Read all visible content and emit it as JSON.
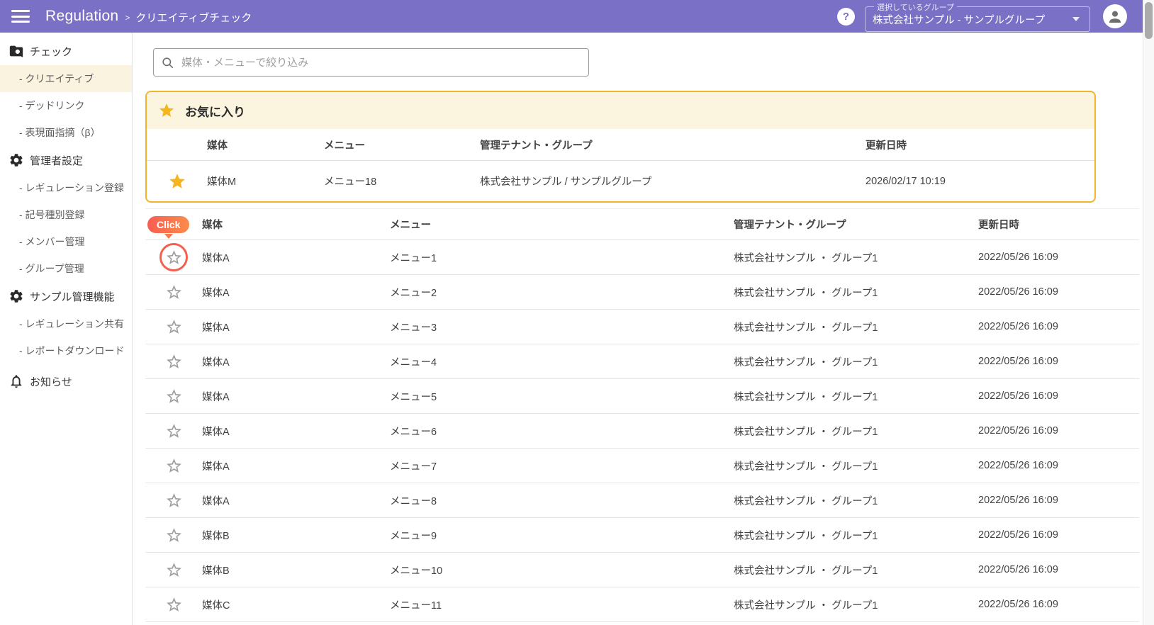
{
  "colors": {
    "header_purple": "#7A70C5",
    "accent_gold": "#F0B42A",
    "favorites_header_bg": "#FBF5DF",
    "active_item_bg": "#FAF3DF",
    "table_header_purple": "#6F66C3",
    "click_gradient_start": "#F85D52",
    "click_gradient_end": "#FB8C4A",
    "click_ring": "#F4604F",
    "star_gold": "#F5B51F",
    "star_gray": "#9E9E9E"
  },
  "header": {
    "app_title": "Regulation",
    "breadcrumb_separator": ">",
    "breadcrumb": "クリエイティブチェック",
    "help_glyph": "?",
    "group_select": {
      "label": "選択しているグループ",
      "value": "株式会社サンプル - サンプルグループ"
    }
  },
  "sidebar": {
    "sections": [
      {
        "label": "チェック",
        "icon": "folder-search-icon",
        "items": [
          {
            "label": "- クリエイティブ",
            "active": true
          },
          {
            "label": "- デッドリンク",
            "active": false
          },
          {
            "label": "- 表現面指摘（β）",
            "active": false
          }
        ]
      },
      {
        "label": "管理者設定",
        "icon": "gear-icon",
        "items": [
          {
            "label": "- レギュレーション登録",
            "active": false
          },
          {
            "label": "- 記号種別登録",
            "active": false
          },
          {
            "label": "- メンバー管理",
            "active": false
          },
          {
            "label": "- グループ管理",
            "active": false
          }
        ]
      },
      {
        "label": "サンプル管理機能",
        "icon": "gear-icon",
        "items": [
          {
            "label": "- レギュレーション共有",
            "active": false
          },
          {
            "label": "- レポートダウンロード",
            "active": false
          }
        ]
      },
      {
        "label": "お知らせ",
        "icon": "bell-icon",
        "items": []
      }
    ]
  },
  "search": {
    "placeholder": "媒体・メニューで絞り込み"
  },
  "favorites": {
    "title": "お気に入り",
    "columns": {
      "media": "媒体",
      "menu": "メニュー",
      "tenant": "管理テナント・グループ",
      "updated": "更新日時"
    },
    "rows": [
      {
        "media": "媒体M",
        "menu": "メニュー18",
        "tenant": "株式会社サンプル / サンプルグループ",
        "updated": "2026/02/17 10:19",
        "favorite": true
      }
    ]
  },
  "main_table": {
    "click_badge": "Click",
    "columns": {
      "media": "媒体",
      "menu": "メニュー",
      "tenant": "管理テナント・グループ",
      "updated": "更新日時"
    },
    "rows": [
      {
        "media": "媒体A",
        "menu": "メニュー1",
        "tenant": "株式会社サンプル ・ グループ1",
        "updated": "2022/05/26 16:09",
        "favorite": false
      },
      {
        "media": "媒体A",
        "menu": "メニュー2",
        "tenant": "株式会社サンプル ・ グループ1",
        "updated": "2022/05/26 16:09",
        "favorite": false
      },
      {
        "media": "媒体A",
        "menu": "メニュー3",
        "tenant": "株式会社サンプル ・ グループ1",
        "updated": "2022/05/26 16:09",
        "favorite": false
      },
      {
        "media": "媒体A",
        "menu": "メニュー4",
        "tenant": "株式会社サンプル ・ グループ1",
        "updated": "2022/05/26 16:09",
        "favorite": false
      },
      {
        "media": "媒体A",
        "menu": "メニュー5",
        "tenant": "株式会社サンプル ・ グループ1",
        "updated": "2022/05/26 16:09",
        "favorite": false
      },
      {
        "media": "媒体A",
        "menu": "メニュー6",
        "tenant": "株式会社サンプル ・ グループ1",
        "updated": "2022/05/26 16:09",
        "favorite": false
      },
      {
        "media": "媒体A",
        "menu": "メニュー7",
        "tenant": "株式会社サンプル ・ グループ1",
        "updated": "2022/05/26 16:09",
        "favorite": false
      },
      {
        "media": "媒体A",
        "menu": "メニュー8",
        "tenant": "株式会社サンプル ・ グループ1",
        "updated": "2022/05/26 16:09",
        "favorite": false
      },
      {
        "media": "媒体B",
        "menu": "メニュー9",
        "tenant": "株式会社サンプル ・ グループ1",
        "updated": "2022/05/26 16:09",
        "favorite": false
      },
      {
        "media": "媒体B",
        "menu": "メニュー10",
        "tenant": "株式会社サンプル ・ グループ1",
        "updated": "2022/05/26 16:09",
        "favorite": false
      },
      {
        "media": "媒体C",
        "menu": "メニュー11",
        "tenant": "株式会社サンプル ・ グループ1",
        "updated": "2022/05/26 16:09",
        "favorite": false
      }
    ]
  }
}
